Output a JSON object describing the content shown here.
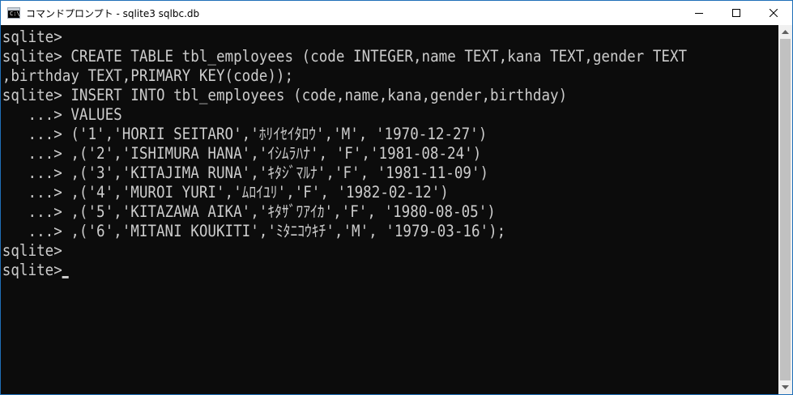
{
  "window": {
    "title": "コマンドプロンプト - sqlite3  sqlbc.db",
    "app_icon_text": "C:\\."
  },
  "console": {
    "lines": [
      "sqlite>",
      "sqlite> CREATE TABLE tbl_employees (code INTEGER,name TEXT,kana TEXT,gender TEXT",
      ",birthday TEXT,PRIMARY KEY(code));",
      "sqlite> INSERT INTO tbl_employees (code,name,kana,gender,birthday)",
      "   ...> VALUES",
      "   ...> ('1','HORII SEITARO','ﾎﾘｲｾｲﾀﾛｳ','M', '1970-12-27')",
      "   ...> ,('2','ISHIMURA HANA','ｲｼﾑﾗﾊﾅ', 'F','1981-08-24')",
      "   ...> ,('3','KITAJIMA RUNA','ｷﾀｼﾞﾏﾙﾅ','F', '1981-11-09')",
      "   ...> ,('4','MUROI YURI','ﾑﾛｲﾕﾘ','F', '1982-02-12')",
      "   ...> ,('5','KITAZAWA AIKA','ｷﾀｻﾞﾜｱｲｶ','F', '1980-08-05')",
      "   ...> ,('6','MITANI KOUKITI','ﾐﾀﾆｺｳｷﾁ','M', '1979-03-16');",
      "sqlite>",
      "sqlite>"
    ]
  }
}
